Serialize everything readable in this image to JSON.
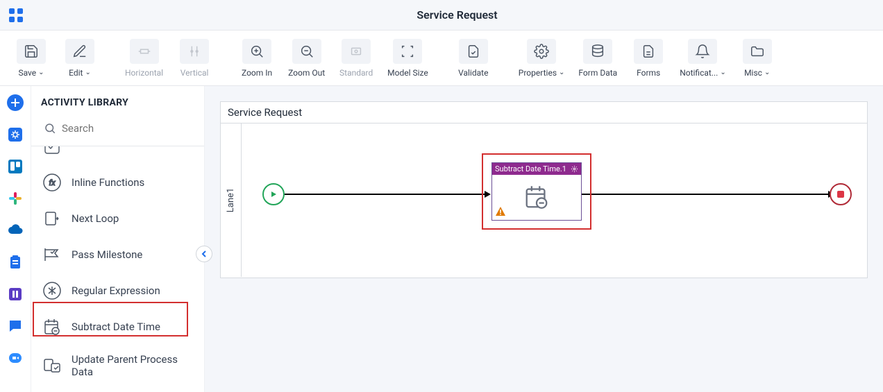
{
  "header": {
    "title": "Service Request"
  },
  "toolbar": {
    "save": "Save",
    "edit": "Edit",
    "horizontal": "Horizontal",
    "vertical": "Vertical",
    "zoom_in": "Zoom In",
    "zoom_out": "Zoom Out",
    "standard": "Standard",
    "model_size": "Model Size",
    "validate": "Validate",
    "properties": "Properties",
    "form_data": "Form Data",
    "forms": "Forms",
    "notifications": "Notificat...",
    "misc": "Misc"
  },
  "sidebar": {
    "header": "ACTIVITY LIBRARY",
    "search_placeholder": "Search",
    "items": [
      {
        "label": ""
      },
      {
        "label": "Inline Functions"
      },
      {
        "label": "Next Loop"
      },
      {
        "label": "Pass Milestone"
      },
      {
        "label": "Regular Expression"
      },
      {
        "label": "Subtract Date Time"
      },
      {
        "label": "Update Parent Process Data"
      }
    ]
  },
  "canvas": {
    "title": "Service Request",
    "lane_label": "Lane1",
    "node": {
      "title": "Subtract Date Time.1"
    }
  }
}
